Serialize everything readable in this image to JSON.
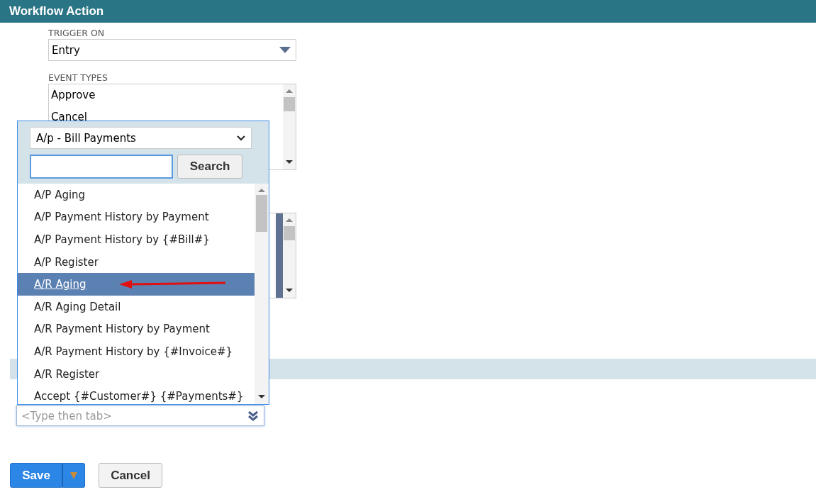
{
  "header": {
    "title": "Workflow Action"
  },
  "trigger": {
    "label": "TRIGGER ON",
    "value": "Entry"
  },
  "event_types": {
    "label": "EVENT TYPES",
    "items": [
      {
        "label": "Approve"
      },
      {
        "label": "Cancel"
      }
    ]
  },
  "second_list": {
    "has_selection": true
  },
  "popup": {
    "category": "A/p - Bill Payments",
    "search_button": "Search",
    "items": [
      {
        "label": "A/P Aging",
        "selected": false
      },
      {
        "label": "A/P Payment History by Payment",
        "selected": false
      },
      {
        "label": "A/P Payment History by {#Bill#}",
        "selected": false
      },
      {
        "label": "A/P Register",
        "selected": false
      },
      {
        "label": "A/R Aging",
        "selected": true
      },
      {
        "label": "A/R Aging Detail",
        "selected": false
      },
      {
        "label": "A/R Payment History by Payment",
        "selected": false
      },
      {
        "label": "A/R Payment History by {#Invoice#}",
        "selected": false
      },
      {
        "label": "A/R Register",
        "selected": false
      },
      {
        "label": "Accept {#Customer#} {#Payments#}",
        "selected": false
      }
    ],
    "annotation_arrow": true
  },
  "type_field": {
    "placeholder": "<Type then tab>"
  },
  "buttons": {
    "save": "Save",
    "cancel": "Cancel"
  }
}
